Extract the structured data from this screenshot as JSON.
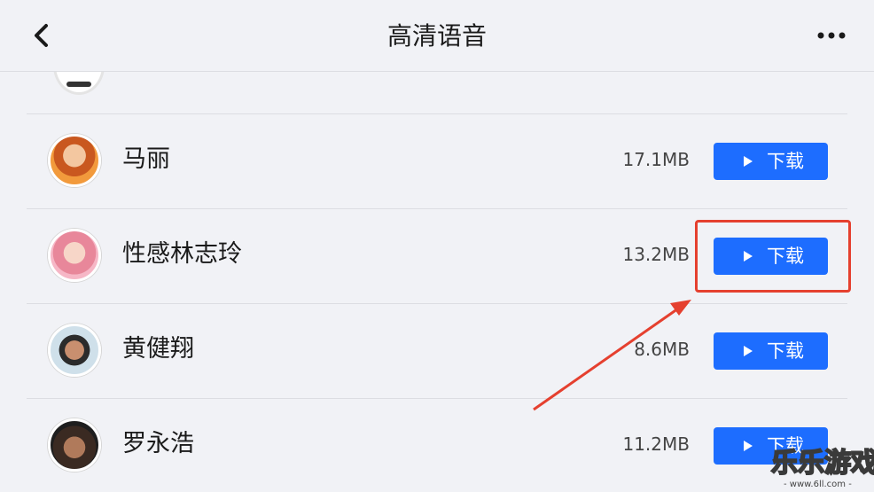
{
  "header": {
    "title": "高清语音",
    "back_icon": "chevron-left-icon",
    "more_icon": "more-horizontal-icon"
  },
  "voices": [
    {
      "name": "马丽",
      "size": "17.1MB",
      "button_label": "下载"
    },
    {
      "name": "性感林志玲",
      "size": "13.2MB",
      "button_label": "下载"
    },
    {
      "name": "黄健翔",
      "size": "8.6MB",
      "button_label": "下载"
    },
    {
      "name": "罗永浩",
      "size": "11.2MB",
      "button_label": "下载"
    }
  ],
  "colors": {
    "accent": "#1d6dff",
    "annotation": "#e5402f",
    "background": "#f1f2f6"
  },
  "watermark": {
    "text": "乐乐游戏",
    "subtext": "- www.6ll.com -"
  }
}
